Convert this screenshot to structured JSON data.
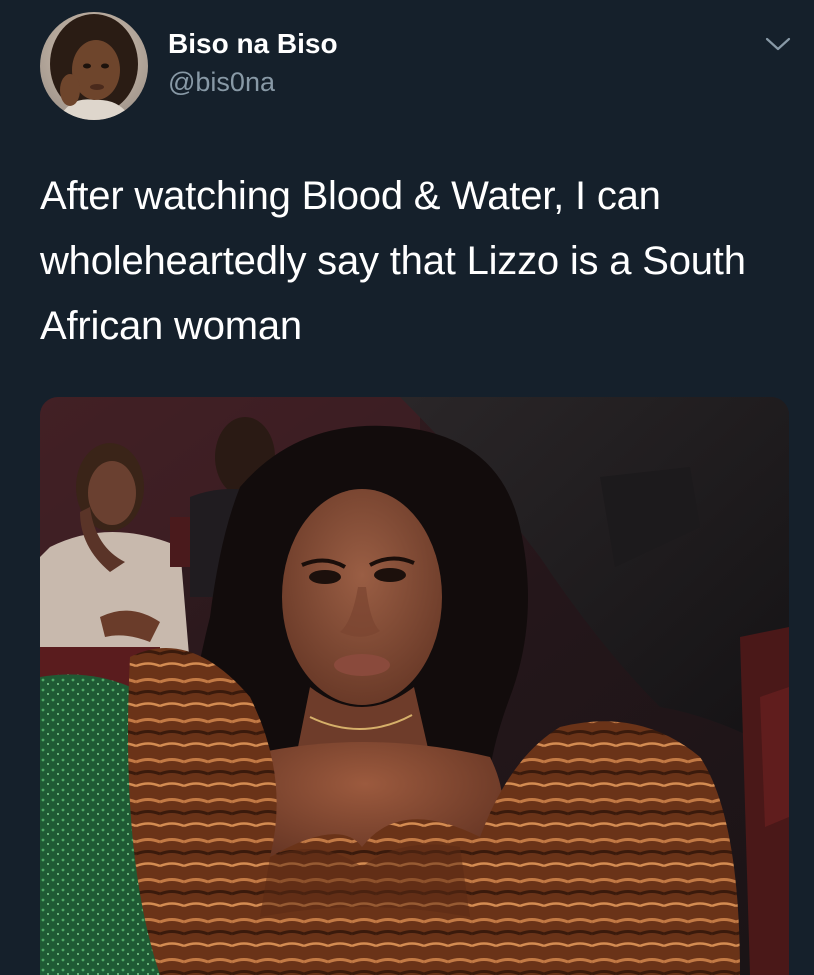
{
  "author": {
    "display_name": "Biso na Biso",
    "handle": "@bis0na"
  },
  "tweet": {
    "text": "After watching Blood & Water, I can wholeheartedly say that Lizzo is a South African woman"
  },
  "icons": {
    "menu": "chevron-down-icon"
  },
  "colors": {
    "background": "#15202b",
    "primary_text": "#ffffff",
    "secondary_text": "#8899a6"
  }
}
